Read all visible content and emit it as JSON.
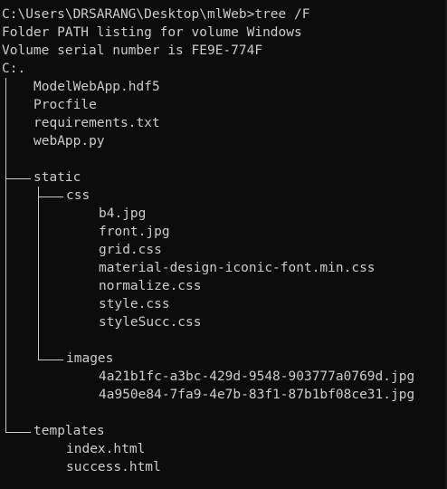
{
  "colors": {
    "background": "#0c0c0c",
    "foreground": "#cccccc"
  },
  "header": {
    "command_line": "C:\\Users\\DRSARANG\\Desktop\\mlWeb>tree /F",
    "listing_line": "Folder PATH listing for volume Windows",
    "serial_line": "Volume serial number is FE9E-774F",
    "root": "C:."
  },
  "tree": {
    "root_files": [
      "ModelWebApp.hdf5",
      "Procfile",
      "requirements.txt",
      "webApp.py"
    ],
    "static": {
      "name": "static",
      "css": {
        "name": "css",
        "files": [
          "b4.jpg",
          "front.jpg",
          "grid.css",
          "material-design-iconic-font.min.css",
          "normalize.css",
          "style.css",
          "styleSucc.css"
        ]
      },
      "images": {
        "name": "images",
        "files": [
          "4a21b1fc-a3bc-429d-9548-903777a0769d.jpg",
          "4a950e84-7fa9-4e7b-83f1-87b1bf08ce31.jpg"
        ]
      }
    },
    "templates": {
      "name": "templates",
      "files": [
        "index.html",
        "success.html"
      ]
    }
  }
}
